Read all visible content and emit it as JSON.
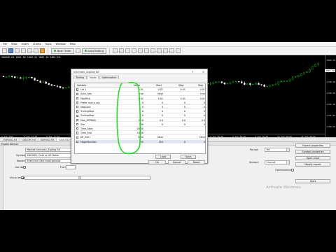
{
  "menu": [
    "File",
    "View",
    "Insert",
    "Charts",
    "Tools",
    "Window",
    "Help"
  ],
  "toolbar": {
    "new_order": "New Order",
    "auto_trading": "AutoTrading"
  },
  "chart": {
    "title": "XAUUSD,H4  1801.58 1803.41 1802.10 1801.20",
    "prices": [
      "1804.25",
      "1801.20",
      "1798.90",
      "1796.55",
      "1794.20",
      "1791.85",
      "1789.50"
    ],
    "current_price": "1801.20",
    "times": [
      "6 Sep 2021",
      "6 Sep 14:00",
      "6 Sep 17:20",
      "7 Sep 09:00",
      "7 Sep 12:00",
      "7 Sep 16:00",
      "8 Sep 08:00",
      "8 Sep 12:00",
      "9 Sep 00:00",
      "9 Sep 08:00",
      "9 Sep 16:00",
      "10 Sep 00:00",
      "10 Sep 08:00",
      "10 Sep 16:00"
    ],
    "colors": {
      "background": "#000000",
      "bull": "#00c800",
      "bear": "#ffffff"
    }
  },
  "symbol_tabs": [
    "EURUSD,H4",
    "USDCHF,H4",
    "GBPUSD,H4",
    "XAUUSD,H4"
  ],
  "tester": {
    "header": "Expert Advisor",
    "expert_value": "Market Ichimoku_ZigZag EA",
    "symbol_label": "Symbol:",
    "symbol_value": "XAUUSD, Gold vs US Dollar",
    "model_label": "Model:",
    "model_value": "Every tick (the most precise",
    "use_date_label": "Use date",
    "from_label": "From:",
    "visual_mode_label": "Visual mode",
    "period_label": "Period:",
    "period_value": "H4",
    "spread_label": "Spread:",
    "spread_value": "Current",
    "optimization_label": "Optimization",
    "buttons": {
      "expert_properties": "Expert properties",
      "symbol_properties": "Symbol properties",
      "open_chart": "Open chart",
      "modify_expert": "Modify expert",
      "start": "Start"
    },
    "watermark": "Activate Windows"
  },
  "dialog": {
    "title": "Ichimoku_ZigZag EA",
    "help": "?",
    "close": "✕",
    "tabs": [
      "Testing",
      "Inputs",
      "Optimization"
    ],
    "active_tab": 1,
    "columns": [
      "Variable",
      "Value",
      "Start",
      "Step",
      "Stop"
    ],
    "rows": [
      {
        "name": "Lot 1",
        "value": "0.01",
        "start": "0.01",
        "step": "0.01",
        "stop": "0.01"
      },
      {
        "name": "Auto_Lots",
        "value": "true",
        "start": "false",
        "step": "",
        "stop": "true"
      },
      {
        "name": "MaxRisk",
        "value": "0.01",
        "start": "0.01",
        "step": "0.01",
        "stop": "0.01"
      },
      {
        "name": "Prefer not to use",
        "value": "0",
        "start": "0",
        "step": "0",
        "stop": "0"
      },
      {
        "name": "StopLoss",
        "value": "0",
        "start": "0",
        "step": "0",
        "stop": "0"
      },
      {
        "name": "TrailingStop",
        "value": "0",
        "start": "0",
        "step": "0",
        "stop": "0"
      },
      {
        "name": "TrailingStep",
        "value": "0",
        "start": "0",
        "step": "0",
        "stop": "0"
      },
      {
        "name": "Max_SPREAD",
        "value": "20.0",
        "start": "0.0",
        "step": "0.0",
        "stop": "0.0"
      },
      {
        "name": "Slip",
        "value": "200",
        "start": "0",
        "step": "0",
        "stop": "0"
      },
      {
        "name": "Time_Start",
        "value": "00:00",
        "start": "",
        "step": "",
        "stop": ""
      },
      {
        "name": "Time_End",
        "value": "23:59",
        "start": "",
        "step": "",
        "stop": ""
      },
      {
        "name": "DF_Astri",
        "value": "false",
        "start": "false",
        "step": "",
        "stop": "false"
      },
      {
        "name": "MagicNumber",
        "value": "555",
        "start": "555",
        "step": "0",
        "stop": "0"
      }
    ],
    "buttons": {
      "load": "Load",
      "save": "Save",
      "ok": "OK",
      "cancel": "Cancel",
      "reset": "Reset"
    },
    "annotation_color": "#22dd22"
  }
}
